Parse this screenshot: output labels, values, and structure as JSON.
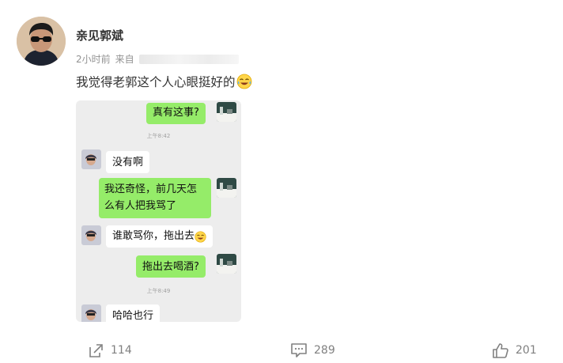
{
  "post": {
    "username": "亲见郭斌",
    "time": "2小时前",
    "source_prefix": "来自",
    "text": "我觉得老郭这个人心眼挺好的",
    "emoji_icon": "crying-laughing-emoji-icon"
  },
  "chat": {
    "messages": [
      {
        "side": "right",
        "text": "真有这事?"
      },
      {
        "type": "time",
        "text": "上午8:42"
      },
      {
        "side": "left",
        "text": "没有啊"
      },
      {
        "side": "right",
        "text_line1": "我还奇怪，前几天怎",
        "text_line2": "么有人把我骂了"
      },
      {
        "side": "left",
        "text": "谁敢骂你，拖出去",
        "emoji_icon": "laughing-emoji-icon"
      },
      {
        "side": "right",
        "text": "拖出去喝酒?"
      },
      {
        "type": "time",
        "text": "上午8:49"
      },
      {
        "side": "left",
        "text": "哈哈也行"
      }
    ]
  },
  "actions": {
    "share_count": "114",
    "comment_count": "289",
    "like_count": "201",
    "share_icon": "share-icon",
    "comment_icon": "comment-icon",
    "like_icon": "thumbs-up-icon"
  },
  "colors": {
    "bubble_green": "#95ec69",
    "chat_bg": "#ededed",
    "meta_gray": "#939393"
  }
}
